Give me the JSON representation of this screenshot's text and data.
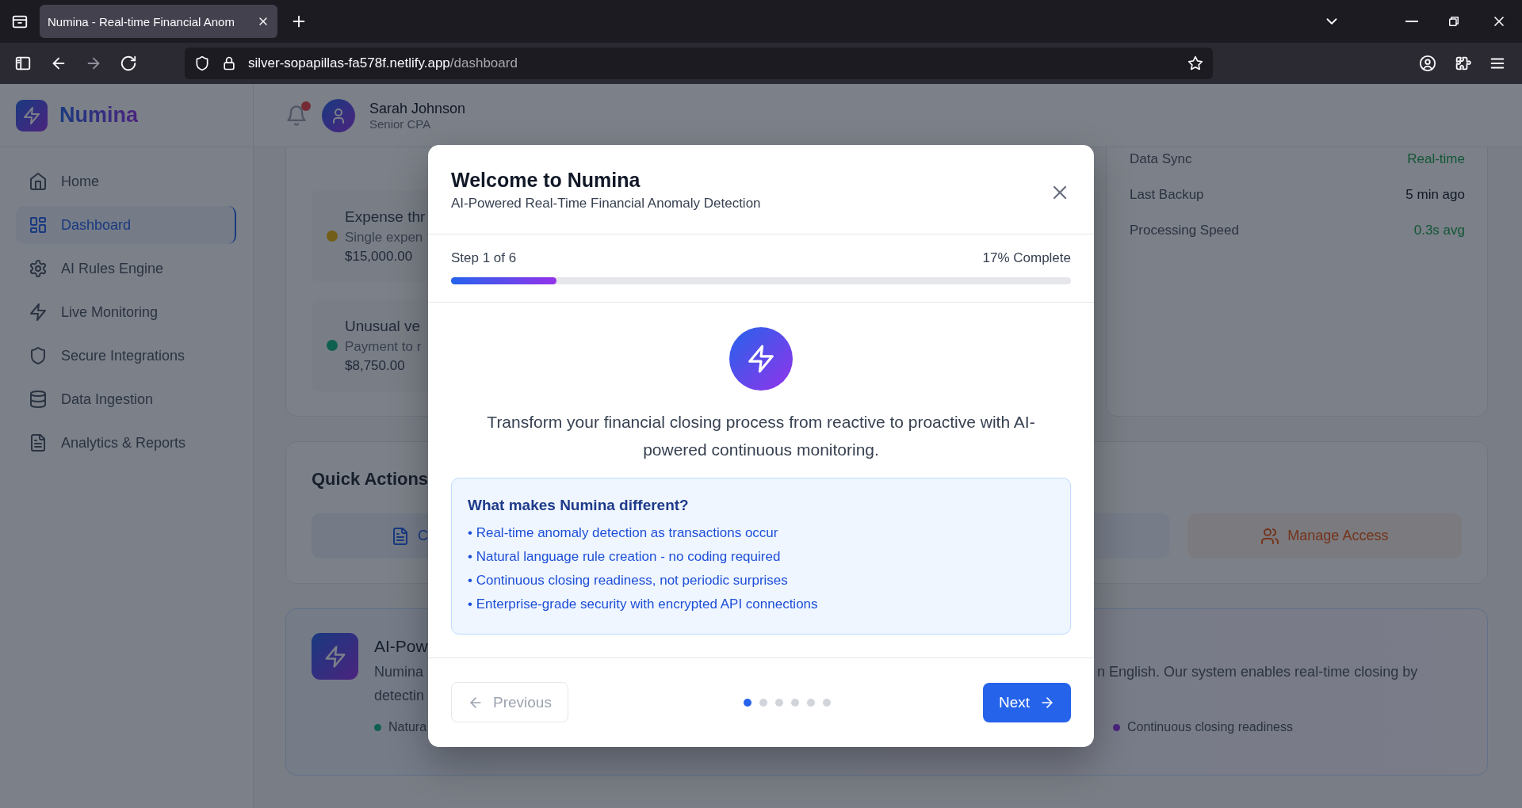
{
  "browser": {
    "tab_title": "Numina - Real-time Financial Anom",
    "url_host": "silver-sopapillas-fa578f.netlify.app",
    "url_path": "/dashboard"
  },
  "sidebar": {
    "logo": "Numina",
    "items": [
      {
        "label": "Home",
        "selected": false
      },
      {
        "label": "Dashboard",
        "selected": true
      },
      {
        "label": "AI Rules Engine",
        "selected": false
      },
      {
        "label": "Live Monitoring",
        "selected": false
      },
      {
        "label": "Secure Integrations",
        "selected": false
      },
      {
        "label": "Data Ingestion",
        "selected": false
      },
      {
        "label": "Analytics & Reports",
        "selected": false
      }
    ]
  },
  "header": {
    "user_name": "Sarah Johnson",
    "user_role": "Senior CPA"
  },
  "alerts": [
    {
      "title": "Expense thr",
      "description": "Single expen",
      "amount": "$15,000.00",
      "color": "#725e19"
    },
    {
      "title": "Unusual ve",
      "description": "Payment to r",
      "amount": "$8,750.00",
      "color": "#11604f"
    }
  ],
  "system_status": [
    {
      "label": "Data Sync",
      "value": "Real-time",
      "kind": "good"
    },
    {
      "label": "Last Backup",
      "value": "5 min ago",
      "kind": "plain"
    },
    {
      "label": "Processing Speed",
      "value": "0.3s avg",
      "kind": "good"
    }
  ],
  "quick_actions": {
    "title": "Quick Actions",
    "actions": [
      {
        "kind": "action",
        "label": "C",
        "color": "#1a3a7f"
      },
      {
        "kind": "blank"
      },
      {
        "kind": "action",
        "label": "Manage Access",
        "color": "#73351b"
      }
    ]
  },
  "feature_card": {
    "title": "AI-Pow",
    "description_left": [
      "Numina",
      "detectin"
    ],
    "description_right": "n English. Our system enables real-time closing by",
    "bullets_left": [
      {
        "text": "Natura",
        "color": "#11604f"
      }
    ],
    "bullets_right": [
      {
        "text": "Continuous closing readiness",
        "color": "#4c247f"
      }
    ]
  },
  "modal": {
    "title": "Welcome to Numina",
    "subtitle": "AI-Powered Real-Time Financial Anomaly Detection",
    "step": "Step 1 of 6",
    "percent": "17% Complete",
    "level": 0.17,
    "intro": "Transform your financial closing process from reactive to proactive with AI-powered continuous monitoring.",
    "box_title": "What makes Numina different?",
    "box_items": [
      "• Real-time anomaly detection as transactions occur",
      "• Natural language rule creation - no coding required",
      "• Continuous closing readiness, not periodic surprises",
      "• Enterprise-grade security with encrypted API connections"
    ],
    "previous": {
      "label": "Previous",
      "disabled": true
    },
    "next": {
      "label": "Next"
    },
    "dots": [
      {
        "selected": true
      },
      {
        "selected": false
      },
      {
        "selected": false
      },
      {
        "selected": false
      },
      {
        "selected": false
      },
      {
        "selected": false
      }
    ]
  }
}
